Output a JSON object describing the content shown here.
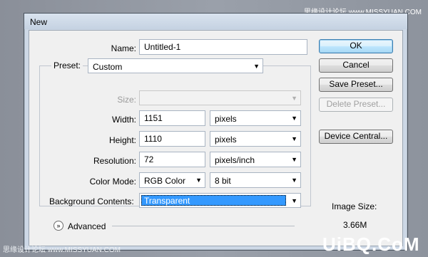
{
  "dialog": {
    "title": "New"
  },
  "form": {
    "name_label": "Name:",
    "name_value": "Untitled-1",
    "preset_label": "Preset:",
    "preset_value": "Custom",
    "size_label": "Size:",
    "width_label": "Width:",
    "width_value": "1151",
    "width_unit": "pixels",
    "height_label": "Height:",
    "height_value": "1110",
    "height_unit": "pixels",
    "resolution_label": "Resolution:",
    "resolution_value": "72",
    "resolution_unit": "pixels/inch",
    "color_mode_label": "Color Mode:",
    "color_mode_value": "RGB Color",
    "bit_depth_value": "8 bit",
    "background_label": "Background Contents:",
    "background_value": "Transparent",
    "advanced_label": "Advanced"
  },
  "buttons": {
    "ok": "OK",
    "cancel": "Cancel",
    "save_preset": "Save Preset...",
    "delete_preset": "Delete Preset...",
    "device_central": "Device Central..."
  },
  "info": {
    "image_size_label": "Image Size:",
    "image_size_value": "3.66M"
  },
  "watermarks": {
    "top_right": "思缘设计论坛 www.MISSYUAN.COM",
    "bottom_left": "思缘设计论坛 www.MISSYUAN.COM",
    "bottom_right": "UiBQ.CoM"
  },
  "icons": {
    "dropdown": "chevron-down-icon",
    "advanced_toggle": "double-chevron-down-icon"
  },
  "colors": {
    "selection": "#3399ff",
    "title_bar": "#cdd8e6",
    "dialog_bg": "#f0f0f0"
  }
}
